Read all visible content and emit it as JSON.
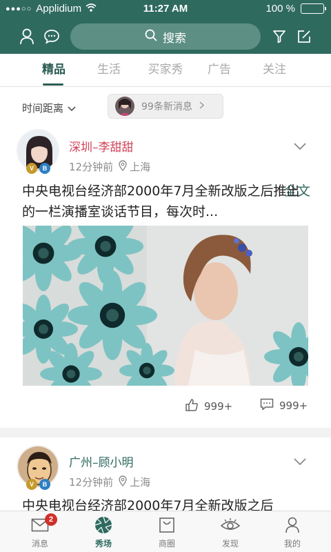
{
  "status_bar": {
    "carrier": "Applidium",
    "time": "11:27 AM",
    "battery": "100 %"
  },
  "search": {
    "label": "搜索"
  },
  "tabs": [
    {
      "label": "精品",
      "active": true
    },
    {
      "label": "生活",
      "active": false
    },
    {
      "label": "买家秀",
      "active": false
    },
    {
      "label": "广告",
      "active": false
    },
    {
      "label": "关注",
      "active": false
    }
  ],
  "filter": {
    "distance_label": "时间距离",
    "new_messages": "99条新消息"
  },
  "posts": [
    {
      "author": "深圳–李甜甜",
      "time": "12分钟前",
      "location": "上海",
      "text": "中央电视台经济部2000年7月全新改版之后推出的一栏演播室谈话节目，每次时...",
      "more_label": "全文",
      "likes": "999+",
      "comments": "999+",
      "badges": [
        "V",
        "B"
      ]
    },
    {
      "author": "广州–顾小明",
      "time": "12分钟前",
      "location": "上海",
      "text": "中央电视台经济部2000年7月全新改版之后",
      "badges": [
        "V",
        "B"
      ]
    }
  ],
  "bottom_nav": [
    {
      "label": "消息",
      "badge": "2"
    },
    {
      "label": "秀场",
      "active": true
    },
    {
      "label": "商圈"
    },
    {
      "label": "发现"
    },
    {
      "label": "我的"
    }
  ],
  "colors": {
    "brand": "#2f6a5f",
    "author_highlight": "#d0455a",
    "badge_red": "#d0302b"
  }
}
